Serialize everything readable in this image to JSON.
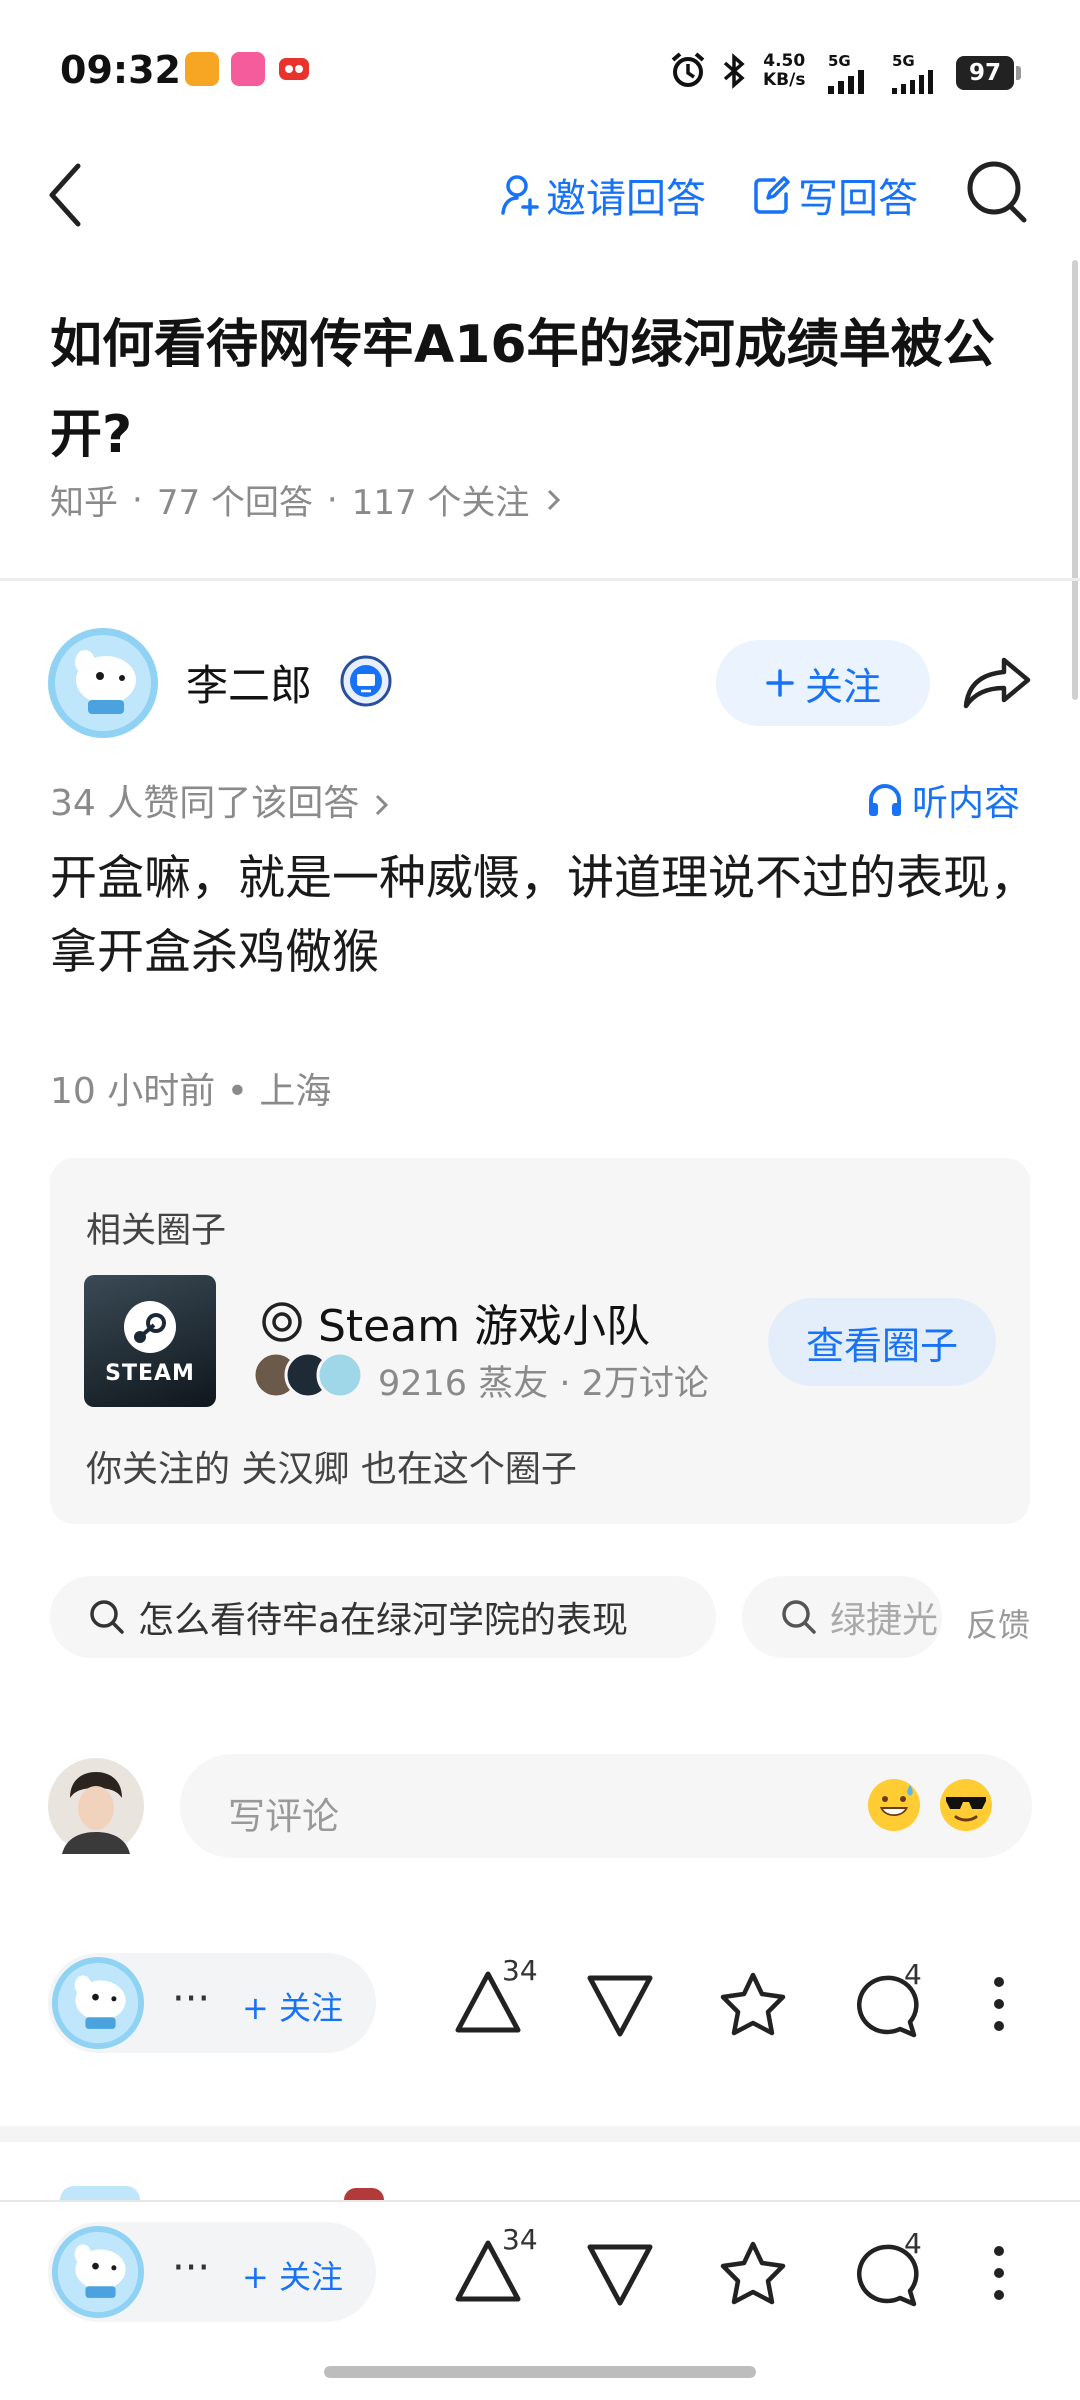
{
  "status_bar": {
    "time": "09:32",
    "net_speed_value": "4.50",
    "net_speed_unit": "KB/s",
    "signal_1": "5G",
    "signal_2": "5G",
    "battery": "97"
  },
  "header": {
    "invite_label": "邀请回答",
    "write_label": "写回答"
  },
  "question": {
    "title": "如何看待网传牢A16年的绿河成绩单被公开?",
    "source": "知乎",
    "answers": "77 个回答",
    "follows": "117 个关注"
  },
  "answer": {
    "author": "李二郎",
    "follow_label": "关注",
    "likes_text": "34 人赞同了该回答",
    "listen_label": "听内容",
    "body": " 开盒嘛，就是一种威慑，讲道理说不过的表现，拿开盒杀鸡儆猴",
    "time_location": "10 小时前 • 上海"
  },
  "circle": {
    "heading": "相关圈子",
    "logo_text": "STEAM",
    "name": "Steam 游戏小队",
    "stats": "9216 蒸友 · 2万讨论",
    "view_label": "查看圈子",
    "note": "你关注的 关汉卿 也在这个圈子"
  },
  "related_searches": {
    "items": [
      "怎么看待牢a在绿河学院的表现",
      "绿捷光"
    ],
    "feedback": "反馈"
  },
  "comment": {
    "placeholder": "写评论"
  },
  "action_bar": {
    "dots": "···",
    "follow_label": "+ 关注",
    "upvotes": "34",
    "comments": "4"
  },
  "colors": {
    "accent": "#1772f6",
    "text_primary": "#121212",
    "text_secondary": "#8a8a8a",
    "card_bg": "#f6f6f6"
  },
  "icons": [
    "back-arrow-icon",
    "person-add-icon",
    "edit-icon",
    "search-icon",
    "verified-badge-icon",
    "share-icon",
    "headphones-icon",
    "circle-icon",
    "steam-icon",
    "emoji-sweat-icon",
    "emoji-sunglasses-icon",
    "upvote-icon",
    "downvote-icon",
    "star-icon",
    "comment-icon",
    "more-icon"
  ]
}
